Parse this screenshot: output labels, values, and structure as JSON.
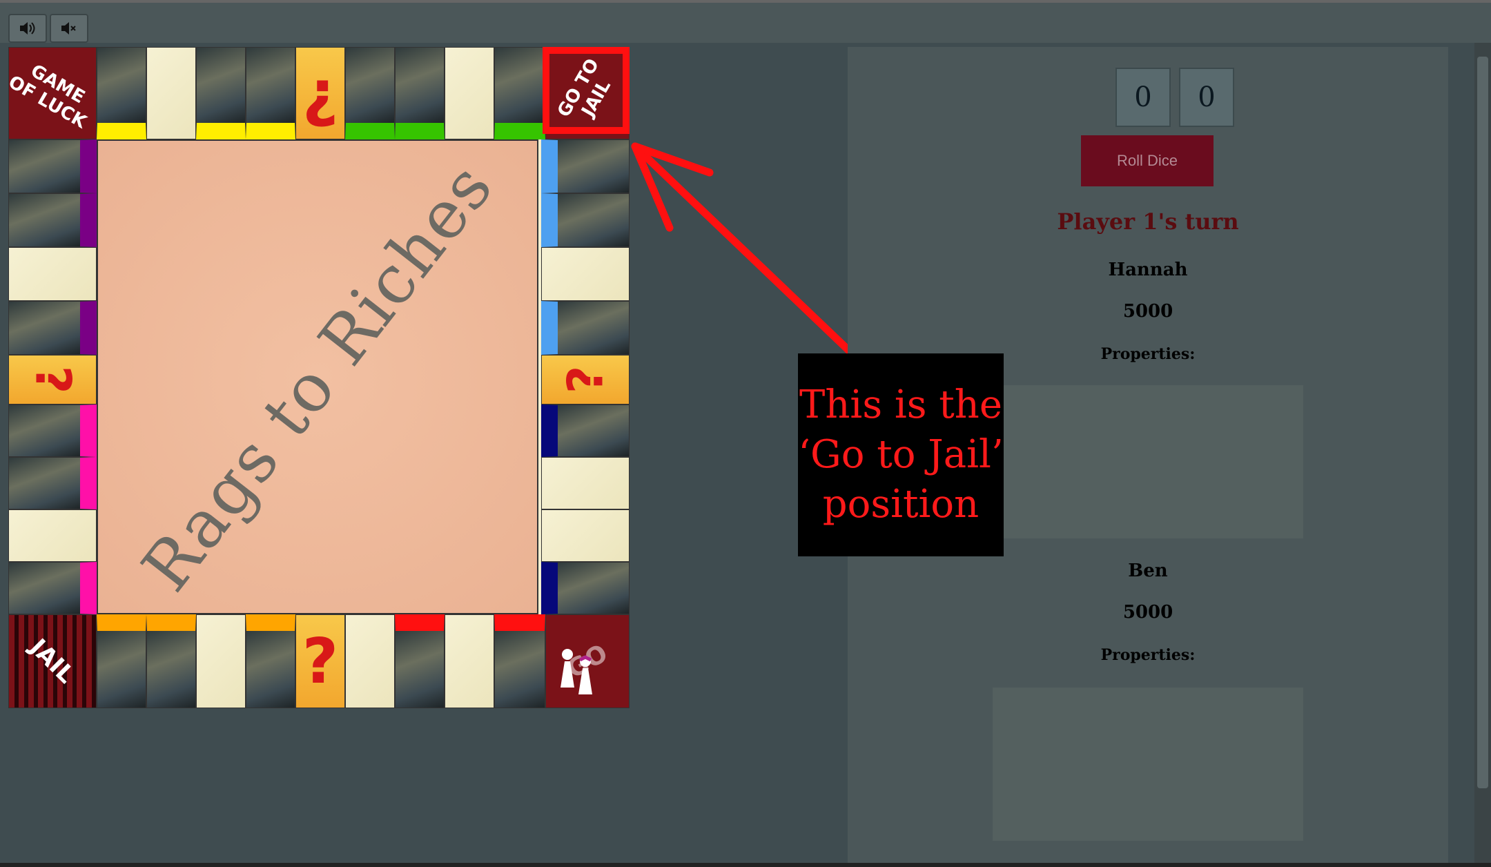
{
  "toolbar": {
    "sound_on_icon": "speaker-on-icon",
    "sound_off_icon": "speaker-mute-icon"
  },
  "board": {
    "title": "Rags to Riches",
    "corners": {
      "top_left": "GAME OF LUCK",
      "top_right": "GO TO JAIL",
      "bottom_left": "JAIL",
      "bottom_right": "GO"
    },
    "question_symbol": "?",
    "question_symbol_inverted": "¿",
    "colors": {
      "yellow": "#ffee00",
      "green": "#36c400",
      "purple": "#7a0085",
      "magenta": "#ff10a8",
      "orange": "#ffa500",
      "red": "#ff1010",
      "lightblue": "#4ea0f0",
      "navy": "#06087a"
    }
  },
  "dice": {
    "die1": "0",
    "die2": "0"
  },
  "roll_button": "Roll Dice",
  "turn_text": "Player 1's turn",
  "players": [
    {
      "name": "Hannah",
      "money": "5000",
      "properties_label": "Properties:"
    },
    {
      "name": "Ben",
      "money": "5000",
      "properties_label": "Properties:"
    }
  ],
  "annotation": {
    "text": "This is the ‘Go to Jail’ position",
    "color": "#ff1a1a"
  }
}
